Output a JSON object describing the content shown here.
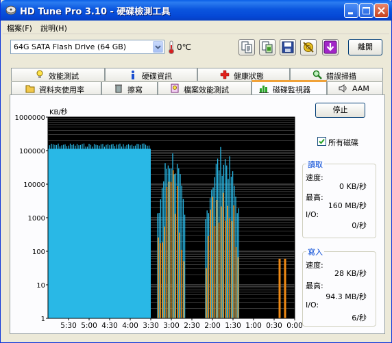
{
  "window": {
    "title": "HD Tune Pro 3.10 - 硬碟檢測工具"
  },
  "menu": {
    "file": "檔案(F)",
    "help": "說明(H)"
  },
  "toolbar": {
    "drive": "64G SATA Flash Drive (64 GB)",
    "temperature": "0℃",
    "exit_label": "離開",
    "icons": [
      "copy-text-icon",
      "copy-screenshot-icon",
      "save-icon",
      "options-icon",
      "download-icon"
    ]
  },
  "tabs": {
    "row1": [
      "效能測試",
      "硬碟資訊",
      "健康狀態",
      "錯誤掃描"
    ],
    "row2": [
      "資料夾使用率",
      "擦寫",
      "檔案效能測試",
      "磁碟監視器",
      "AAM"
    ],
    "active": "磁碟監視器"
  },
  "monitor": {
    "stop_label": "停止",
    "all_disks_label": "所有磁碟",
    "all_disks_checked": true,
    "read": {
      "title": "讀取",
      "speed_label": "速度:",
      "speed_value": "0 KB/秒",
      "max_label": "最高:",
      "max_value": "160 MB/秒",
      "io_label": "I/O:",
      "io_value": "0/秒"
    },
    "write": {
      "title": "寫入",
      "speed_label": "速度:",
      "speed_value": "28 KB/秒",
      "max_label": "最高:",
      "max_value": "94.3 MB/秒",
      "io_label": "I/O:",
      "io_value": "6/秒"
    }
  },
  "chart_data": {
    "type": "bar",
    "ylabel": "KB/秒",
    "yscale": "log",
    "ylim": [
      1,
      1000000
    ],
    "yticks": [
      "1000000",
      "100000",
      "10000",
      "1000",
      "100",
      "10",
      "1"
    ],
    "xticks": [
      "5:30",
      "5:00",
      "4:30",
      "4:00",
      "3:30",
      "3:00",
      "2:30",
      "2:00",
      "1:30",
      "1:00",
      "0:30",
      "0:00"
    ],
    "xlim_seconds_ago": [
      360,
      0
    ],
    "series": [
      {
        "color": "#29b8e6",
        "segments": [
          {
            "from": 360,
            "to": 210,
            "value": 150000
          },
          {
            "from": 200,
            "to": 160,
            "peak": 150000
          },
          {
            "from": 130,
            "to": 80,
            "peak": 150000
          }
        ]
      },
      {
        "color": "#f08a14",
        "segments": [
          {
            "from": 200,
            "to": 160,
            "peak": 90000
          },
          {
            "from": 130,
            "to": 80,
            "peak": 90000
          }
        ]
      }
    ],
    "colors": {
      "background": "#000000",
      "read": "#29b8e6",
      "write": "#f08a14",
      "grid": "#6f6f6f"
    }
  }
}
